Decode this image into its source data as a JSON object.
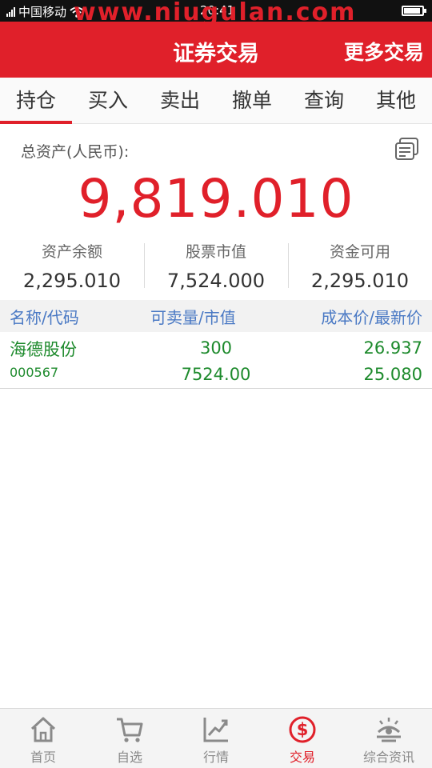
{
  "status": {
    "carrier": "中国移动",
    "time": "20:41"
  },
  "watermark": "www.niugulan.com",
  "header": {
    "title": "证券交易",
    "more": "更多交易"
  },
  "tabs": [
    "持仓",
    "买入",
    "卖出",
    "撤单",
    "查询",
    "其他"
  ],
  "assets": {
    "label": "总资产(人民币):",
    "total": "9,819.010",
    "stats": [
      {
        "label": "资产余额",
        "value": "2,295.010"
      },
      {
        "label": "股票市值",
        "value": "7,524.000"
      },
      {
        "label": "资金可用",
        "value": "2,295.010"
      }
    ]
  },
  "table": {
    "headers": {
      "name": "名称/代码",
      "qty": "可卖量/市值",
      "price": "成本价/最新价"
    },
    "rows": [
      {
        "name": "海德股份",
        "code": "000567",
        "qty": "300",
        "market_value": "7524.00",
        "cost": "26.937",
        "last": "25.080"
      }
    ]
  },
  "nav": [
    {
      "label": "首页",
      "icon": "home-icon"
    },
    {
      "label": "自选",
      "icon": "cart-icon"
    },
    {
      "label": "行情",
      "icon": "chart-icon"
    },
    {
      "label": "交易",
      "icon": "dollar-icon"
    },
    {
      "label": "综合资讯",
      "icon": "news-icon"
    }
  ],
  "colors": {
    "brand": "#e0202a",
    "gain_loss": "#1d8a2c",
    "header_text": "#4a79c4"
  }
}
